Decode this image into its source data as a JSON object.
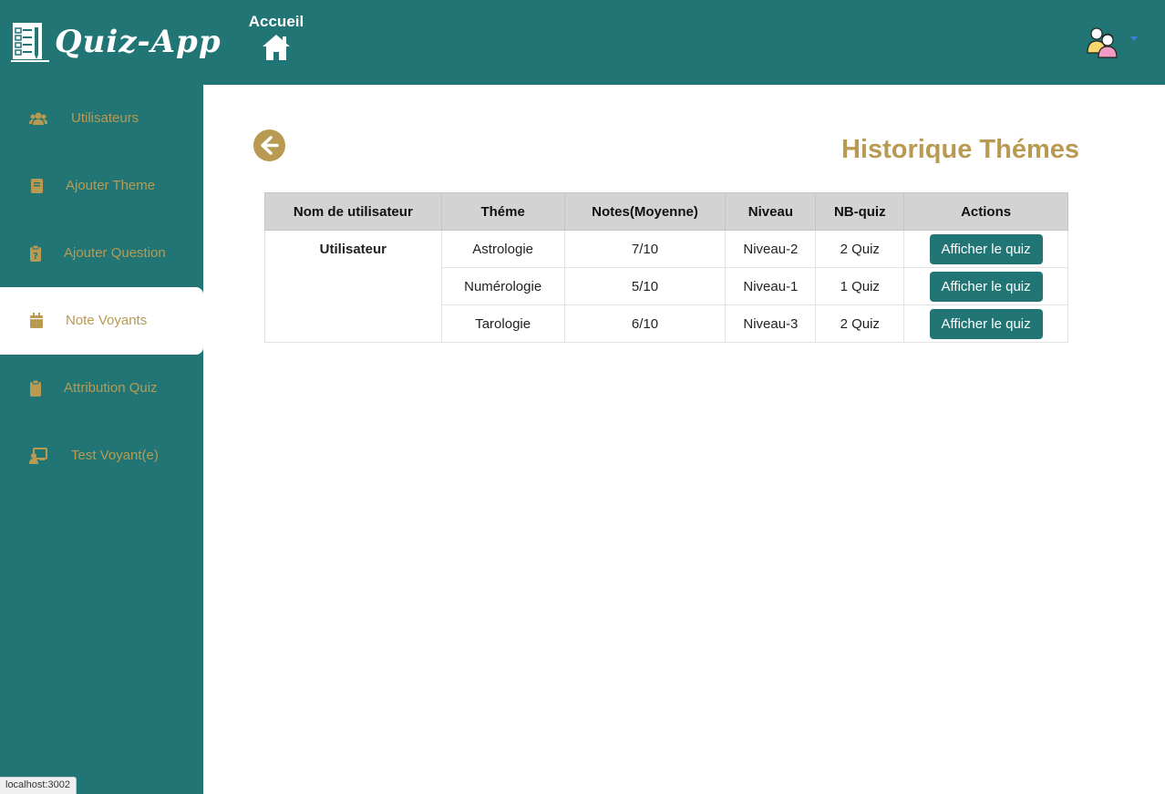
{
  "app": {
    "name": "Quiz-App",
    "colors": {
      "primary": "#217575",
      "accent": "#b89a52",
      "header_bg": "#d3d3d3"
    }
  },
  "header": {
    "home_label": "Accueil",
    "home_icon": "home-icon",
    "avatar_icon": "users-avatar-icon"
  },
  "sidebar": {
    "items": [
      {
        "label": "Utilisateurs",
        "icon": "users-icon",
        "active": false
      },
      {
        "label": "Ajouter Theme",
        "icon": "book-icon",
        "active": false
      },
      {
        "label": "Ajouter Question",
        "icon": "clipboard-question-icon",
        "active": false
      },
      {
        "label": "Note Voyants",
        "icon": "calendar-icon",
        "active": true
      },
      {
        "label": "Attribution Quiz",
        "icon": "clipboard-icon",
        "active": false
      },
      {
        "label": "Test Voyant(e)",
        "icon": "chalkboard-user-icon",
        "active": false
      }
    ]
  },
  "main": {
    "title": "Historique Thémes",
    "back_icon": "arrow-left-circle-icon",
    "table": {
      "headers": [
        "Nom de utilisateur",
        "Théme",
        "Notes(Moyenne)",
        "Niveau",
        "NB-quiz",
        "Actions"
      ],
      "user": "Utilisateur",
      "rows": [
        {
          "theme": "Astrologie",
          "note": "7/10",
          "niveau": "Niveau-2",
          "nb_quiz": "2 Quiz",
          "action": "Afficher le quiz"
        },
        {
          "theme": "Numérologie",
          "note": "5/10",
          "niveau": "Niveau-1",
          "nb_quiz": "1 Quiz",
          "action": "Afficher le quiz"
        },
        {
          "theme": "Tarologie",
          "note": "6/10",
          "niveau": "Niveau-3",
          "nb_quiz": "2 Quiz",
          "action": "Afficher le quiz"
        }
      ]
    }
  },
  "status_bar": {
    "url": "localhost:3002"
  }
}
